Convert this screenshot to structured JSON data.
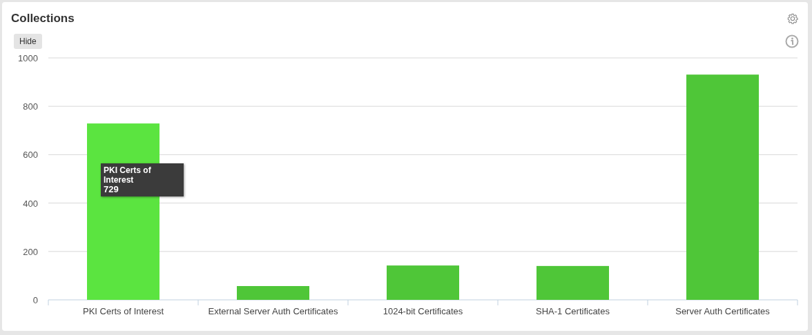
{
  "panel": {
    "title": "Collections",
    "hide_button": "Hide"
  },
  "chart": {
    "chart_data": {
      "type": "bar",
      "categories": [
        "PKI Certs of Interest",
        "External Server Auth Certificates",
        "1024-bit Certificates",
        "SHA-1 Certificates",
        "Server Auth Certificates"
      ],
      "series": [
        {
          "color": "#4fc638",
          "values": [
            729,
            57,
            142,
            140,
            931
          ]
        }
      ],
      "ylim": [
        0,
        1000
      ],
      "grid": true,
      "yticks": [
        0,
        200,
        400,
        600,
        800,
        1000
      ]
    },
    "bars": [
      {
        "hovered": true
      },
      {
        "hovered": false
      },
      {
        "hovered": false
      },
      {
        "hovered": false
      },
      {
        "hovered": false
      }
    ],
    "tooltip": {
      "title": "PKI Certs of Interest",
      "value": "729"
    }
  }
}
